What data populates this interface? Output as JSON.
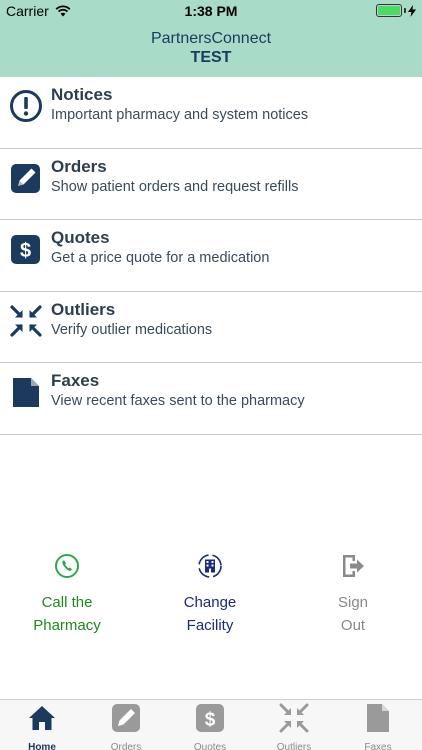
{
  "status_bar": {
    "carrier": "Carrier",
    "time": "1:38 PM"
  },
  "header": {
    "title": "PartnersConnect",
    "subtitle": "TEST"
  },
  "menu": [
    {
      "title": "Notices",
      "subtitle": "Important pharmacy and system notices",
      "icon": "exclamation-circle-icon"
    },
    {
      "title": "Orders",
      "subtitle": "Show patient orders and request refills",
      "icon": "pencil-square-icon"
    },
    {
      "title": "Quotes",
      "subtitle": "Get a price quote for a medication",
      "icon": "dollar-icon"
    },
    {
      "title": "Outliers",
      "subtitle": "Verify outlier medications",
      "icon": "arrows-in-icon"
    },
    {
      "title": "Faxes",
      "subtitle": "View recent faxes sent to the pharmacy",
      "icon": "document-icon"
    }
  ],
  "actions": {
    "call": {
      "line1": "Call the",
      "line2": "Pharmacy",
      "color": "#1e8a1e"
    },
    "change": {
      "line1": "Change",
      "line2": "Facility",
      "color": "#1b2a7a"
    },
    "sign_out": {
      "line1": "Sign",
      "line2": "Out",
      "color": "#888888"
    }
  },
  "tabs": [
    {
      "label": "Home",
      "icon": "home-icon",
      "active": true
    },
    {
      "label": "Orders",
      "icon": "pencil-icon",
      "active": false
    },
    {
      "label": "Quotes",
      "icon": "dollar-icon",
      "active": false
    },
    {
      "label": "Outliers",
      "icon": "arrows-in-icon",
      "active": false
    },
    {
      "label": "Faxes",
      "icon": "document-icon",
      "active": false
    }
  ],
  "colors": {
    "header_bg": "#a8dbc8",
    "primary": "#1b3a5e",
    "call_green": "#1e8a1e",
    "inactive_gray": "#888888"
  }
}
